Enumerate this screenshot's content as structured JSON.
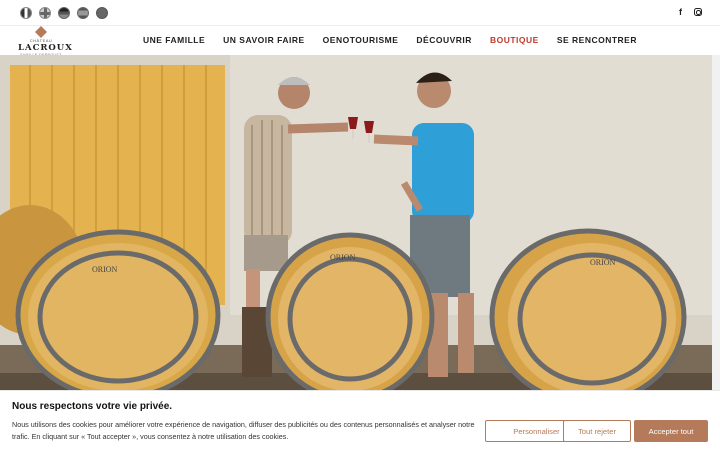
{
  "languages": [
    {
      "code": "fr",
      "icon": "flag-fr-icon"
    },
    {
      "code": "en",
      "icon": "flag-en-icon"
    },
    {
      "code": "de",
      "icon": "flag-de-icon"
    },
    {
      "code": "es",
      "icon": "flag-es-icon"
    },
    {
      "code": "it",
      "icon": "flag-it-icon"
    }
  ],
  "social": {
    "facebook": "f",
    "instagram_icon": "instagram-icon"
  },
  "logo": {
    "sub": "CHÂTEAU",
    "name": "LACROUX",
    "tag": "FAMILLE DERBOUST"
  },
  "nav": {
    "items": [
      "UNE FAMILLE",
      "UN SAVOIR FAIRE",
      "OENOTOURISME",
      "DÉCOUVRIR",
      "BOUTIQUE",
      "SE RENCONTRER"
    ],
    "active_index": 4,
    "active_color": "#c0392b"
  },
  "hero": {
    "barrel_labels": [
      "ORION",
      "ORION",
      "ORION"
    ]
  },
  "cookie": {
    "title": "Nous respectons votre vie privée.",
    "text": "Nous utilisons des cookies pour améliorer votre expérience de navigation, diffuser des publicités ou des contenus personnalisés et analyser notre trafic. En cliquant sur « Tout accepter », vous consentez à notre utilisation des cookies.",
    "customize": "Personnaliser",
    "reject": "Tout rejeter",
    "accept": "Accepter tout",
    "accent": "#b47a5a"
  }
}
